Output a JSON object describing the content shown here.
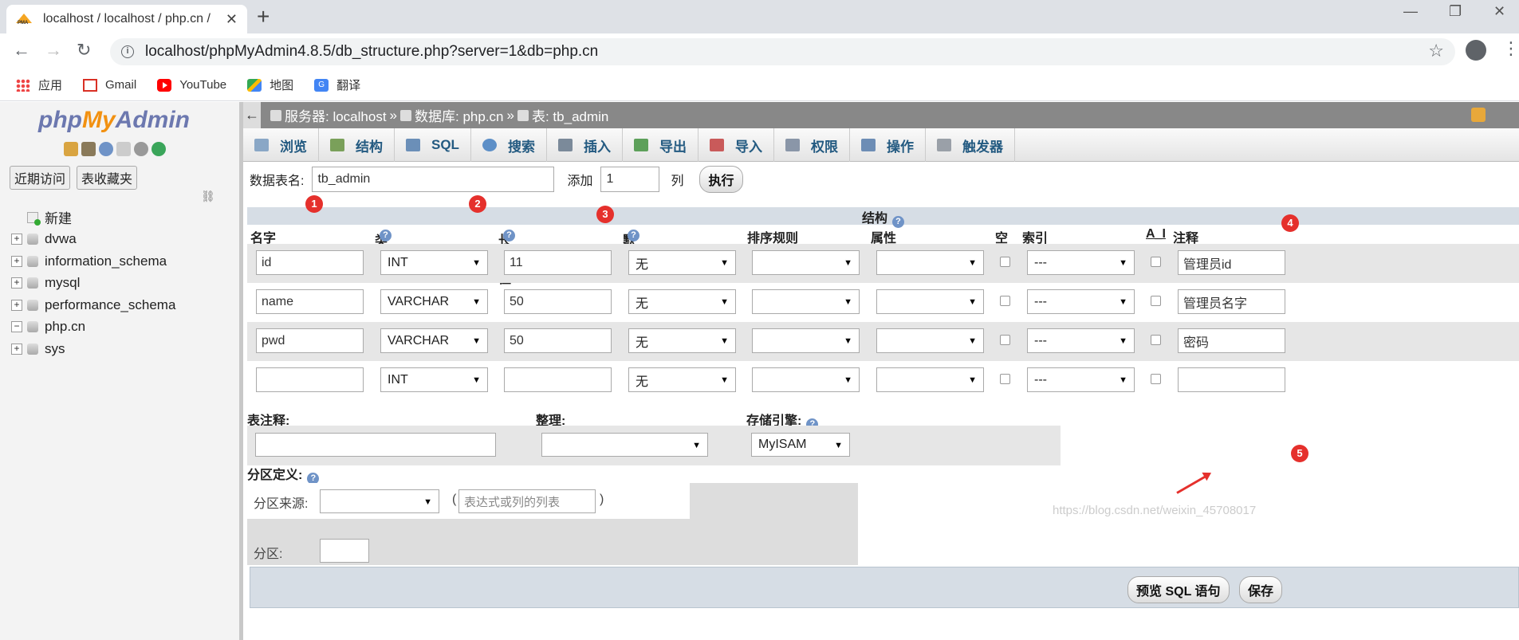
{
  "browser": {
    "tab_title": "localhost / localhost / php.cn /",
    "url": "localhost/phpMyAdmin4.8.5/db_structure.php?server=1&db=php.cn",
    "bookmarks": [
      {
        "label": "应用",
        "icon": "apps-grid-icon"
      },
      {
        "label": "Gmail",
        "icon": "gmail-icon"
      },
      {
        "label": "YouTube",
        "icon": "youtube-icon"
      },
      {
        "label": "地图",
        "icon": "maps-icon"
      },
      {
        "label": "翻译",
        "icon": "translate-icon"
      }
    ]
  },
  "sidebar": {
    "logo_php": "php",
    "logo_my": "My",
    "logo_admin": "Admin",
    "btn_recent": "近期访问",
    "btn_favorites": "表收藏夹",
    "tree": [
      {
        "label": "新建",
        "type": "new"
      },
      {
        "label": "dvwa",
        "type": "db"
      },
      {
        "label": "information_schema",
        "type": "db"
      },
      {
        "label": "mysql",
        "type": "db"
      },
      {
        "label": "performance_schema",
        "type": "db"
      },
      {
        "label": "php.cn",
        "type": "db-open"
      },
      {
        "label": "sys",
        "type": "db"
      }
    ]
  },
  "breadcrumb": {
    "server": "服务器: localhost",
    "database": "数据库: php.cn",
    "table": "表: tb_admin",
    "sep": "»"
  },
  "menu": [
    {
      "label": "浏览",
      "icon": "browse-icon",
      "color": "#8aa7c6"
    },
    {
      "label": "结构",
      "icon": "structure-icon",
      "color": "#7aa05a"
    },
    {
      "label": "SQL",
      "icon": "sql-icon",
      "color": "#6b8fb8"
    },
    {
      "label": "搜索",
      "icon": "search-icon",
      "color": "#5d8fc7"
    },
    {
      "label": "插入",
      "icon": "insert-icon",
      "color": "#7b8a9a"
    },
    {
      "label": "导出",
      "icon": "export-icon",
      "color": "#5da05a"
    },
    {
      "label": "导入",
      "icon": "import-icon",
      "color": "#c95a5a"
    },
    {
      "label": "权限",
      "icon": "privileges-icon",
      "color": "#8a96a8"
    },
    {
      "label": "操作",
      "icon": "operations-icon",
      "color": "#6d8db5"
    },
    {
      "label": "触发器",
      "icon": "triggers-icon",
      "color": "#9aa0a8"
    }
  ],
  "table_form": {
    "table_name_label": "数据表名:",
    "table_name_value": "tb_admin",
    "add_label": "添加",
    "add_count": "1",
    "col_label": "列",
    "exec_button": "执行"
  },
  "structure": {
    "section_title": "结构",
    "headers": {
      "name": "名字",
      "type": "类型",
      "length": "长度/值",
      "default": "默认",
      "collation": "排序规则",
      "attributes": "属性",
      "null": "空",
      "index": "索引",
      "ai": "A_I",
      "comment": "注释"
    },
    "rows": [
      {
        "name": "id",
        "type": "INT",
        "length": "11",
        "default": "无",
        "index": "---",
        "comment": "管理员id"
      },
      {
        "name": "name",
        "type": "VARCHAR",
        "length": "50",
        "default": "无",
        "index": "---",
        "comment": "管理员名字"
      },
      {
        "name": "pwd",
        "type": "VARCHAR",
        "length": "50",
        "default": "无",
        "index": "---",
        "comment": "密码"
      },
      {
        "name": "",
        "type": "INT",
        "length": "",
        "default": "无",
        "index": "---",
        "comment": ""
      }
    ]
  },
  "table_options": {
    "comment_label": "表注释:",
    "collation_label": "整理:",
    "engine_label": "存储引擎:",
    "engine_value": "MyISAM"
  },
  "partition": {
    "title": "分区定义:",
    "source_label": "分区来源:",
    "expr_placeholder": "表达式或列的列表",
    "open_paren": "(",
    "close_paren": ")",
    "partitions_label": "分区:"
  },
  "footer": {
    "preview_button": "预览 SQL 语句",
    "save_button": "保存"
  },
  "annotations": [
    "1",
    "2",
    "3",
    "4",
    "5"
  ],
  "watermark": "https://blog.csdn.net/weixin_45708017",
  "colors": {
    "accent_link": "#235a81",
    "annotation_red": "#e5302c",
    "header_bg": "#d6dde5"
  }
}
